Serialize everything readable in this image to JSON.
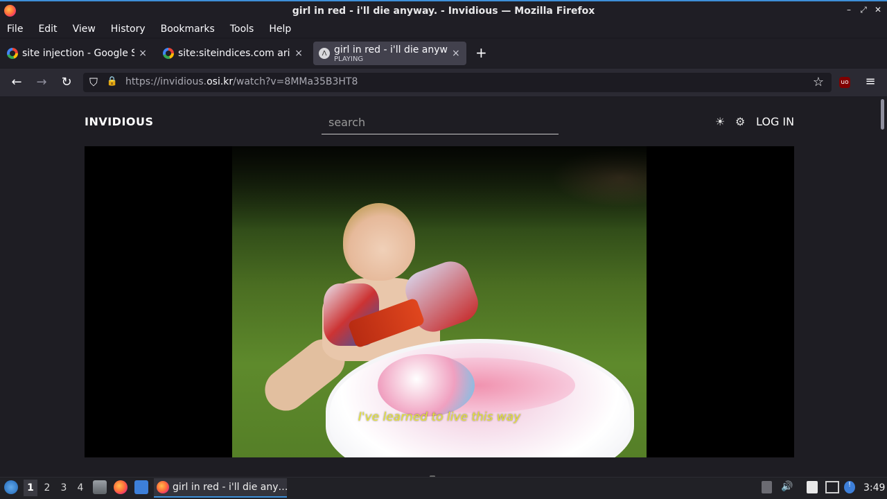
{
  "window": {
    "title": "girl in red - i'll die anyway. - Invidious — Mozilla Firefox",
    "controls": {
      "minimize": "–",
      "maximize": "⤢",
      "close": "✕"
    }
  },
  "menu": [
    "File",
    "Edit",
    "View",
    "History",
    "Bookmarks",
    "Tools",
    "Help"
  ],
  "tabs": [
    {
      "label": "site injection - Google Se",
      "close": "×",
      "icon": "google-icon"
    },
    {
      "label": "site:siteindices.com ari-w",
      "close": "×",
      "icon": "google-icon"
    },
    {
      "label": "girl in red - i'll die anywa",
      "sub": "PLAYING",
      "close": "×",
      "icon": "invidious-icon",
      "icon_glyph": "Λ"
    }
  ],
  "new_tab": "+",
  "nav": {
    "back": "←",
    "forward": "→",
    "reload": "↻",
    "shield": "⛉",
    "lock": "🔒",
    "url_prefix": "https://invidious.",
    "url_host": "osi.kr",
    "url_suffix": "/watch?v=8MMa35B3HT8",
    "bookmark": "☆",
    "ublock": "uo",
    "menu": "≡"
  },
  "site": {
    "brand": "INVIDIOUS",
    "search_placeholder": "search",
    "theme_icon": "☀",
    "settings_icon": "⚙",
    "login": "LOG IN"
  },
  "video": {
    "subtitle": "I've learned to live this way"
  },
  "taskbar": {
    "workspaces": [
      "1",
      "2",
      "3",
      "4"
    ],
    "active_workspace": "1",
    "task_label": "girl in red - i'll die any…",
    "tray": {
      "volume": "🔊",
      "clock": "3:49"
    }
  },
  "colors": {
    "accent": "#3d8fd9",
    "subtitle": "#e5e23b",
    "page_bg": "#1e1d23"
  }
}
